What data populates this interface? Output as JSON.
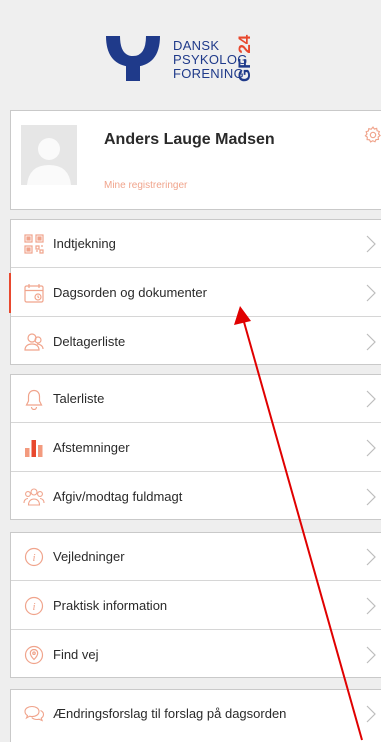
{
  "logo": {
    "lines": [
      "DANSK",
      "PSYKOLOG",
      "FORENING"
    ],
    "badge": "GF24",
    "colors": {
      "blue": "#1f3a8a",
      "orange": "#e8482e"
    }
  },
  "profile": {
    "name": "Anders Lauge Madsen",
    "link": "Mine registreringer",
    "settings_icon": "gear-icon"
  },
  "groups": [
    {
      "items": [
        {
          "label": "Indtjekning",
          "icon": "qr-code-icon"
        },
        {
          "label": "Dagsorden og dokumenter",
          "icon": "calendar-icon",
          "active": true
        },
        {
          "label": "Deltagerliste",
          "icon": "people-icon"
        }
      ]
    },
    {
      "items": [
        {
          "label": "Talerliste",
          "icon": "bell-icon"
        },
        {
          "label": "Afstemninger",
          "icon": "bar-chart-icon"
        },
        {
          "label": "Afgiv/modtag fuldmagt",
          "icon": "group-icon"
        }
      ]
    },
    {
      "items": [
        {
          "label": "Vejledninger",
          "icon": "info-icon"
        },
        {
          "label": "Praktisk information",
          "icon": "info-icon"
        },
        {
          "label": "Find vej",
          "icon": "location-pin-icon"
        }
      ]
    },
    {
      "items": [
        {
          "label": "Ændringsforslag til forslag på dagsorden",
          "icon": "speech-bubbles-icon"
        }
      ]
    }
  ],
  "accent_color": "#e8482e",
  "annotation_arrow_color": "#e00000"
}
